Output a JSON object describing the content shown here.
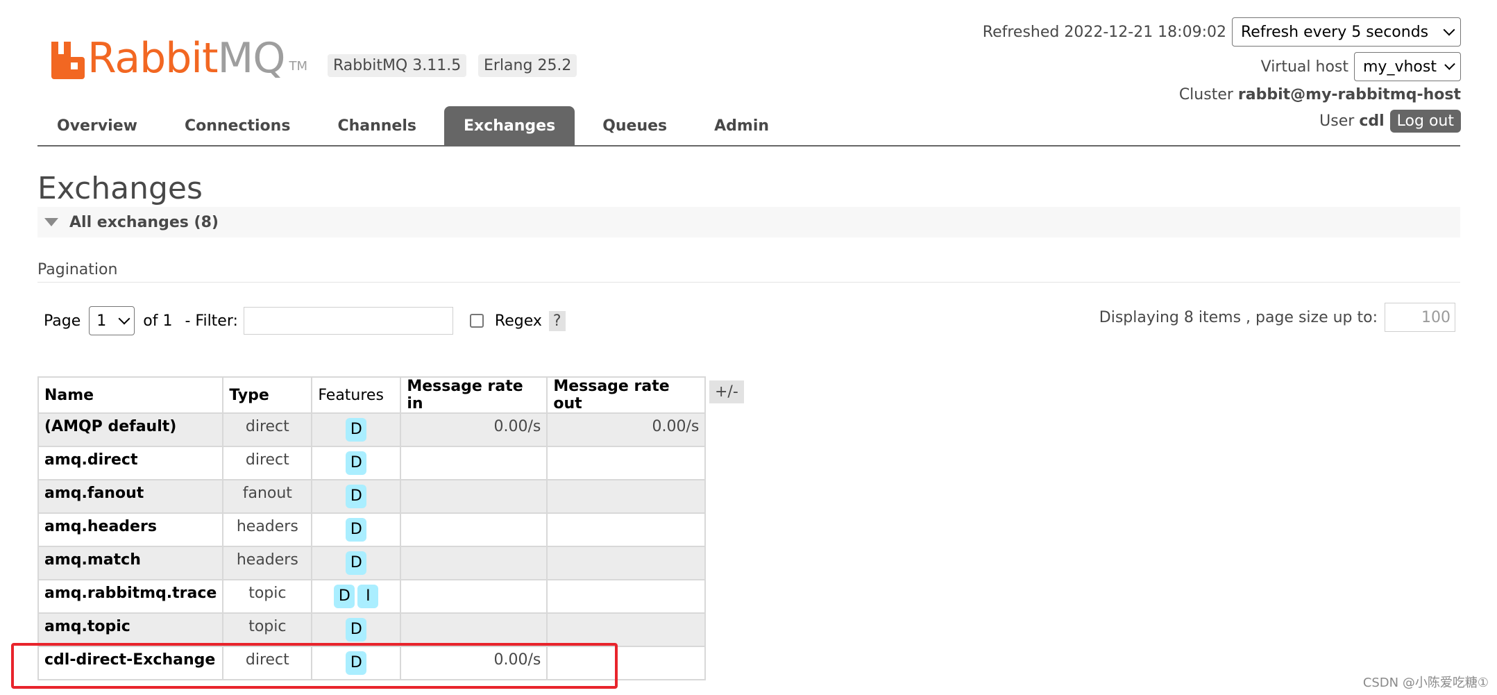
{
  "logo": {
    "rabbit": "Rabbit",
    "mq": "MQ",
    "tm": "TM"
  },
  "versions": [
    "RabbitMQ 3.11.5",
    "Erlang 25.2"
  ],
  "header": {
    "refreshed_label": "Refreshed 2022-12-21 18:09:02",
    "refresh_select": "Refresh every 5 seconds",
    "vhost_label": "Virtual host",
    "vhost_select": "my_vhost",
    "cluster_label": "Cluster",
    "cluster_name": "rabbit@my-rabbitmq-host",
    "user_label": "User",
    "user_name": "cdl",
    "logout": "Log out"
  },
  "nav": {
    "tabs": [
      {
        "label": "Overview",
        "active": false
      },
      {
        "label": "Connections",
        "active": false
      },
      {
        "label": "Channels",
        "active": false
      },
      {
        "label": "Exchanges",
        "active": true
      },
      {
        "label": "Queues",
        "active": false
      },
      {
        "label": "Admin",
        "active": false
      }
    ]
  },
  "page": {
    "title": "Exchanges",
    "section": "All exchanges (8)",
    "pagination_label": "Pagination"
  },
  "pager": {
    "page_label": "Page",
    "page_value": "1",
    "of_label": "of 1",
    "filter_label": "- Filter:",
    "filter_value": "",
    "regex_label": "Regex",
    "help": "?",
    "display_info": "Displaying 8 items , page size up to:",
    "page_size": "100"
  },
  "table": {
    "columns": [
      "Name",
      "Type",
      "Features",
      "Message rate in",
      "Message rate out"
    ],
    "toggle": "+/-",
    "rows": [
      {
        "name": "(AMQP default)",
        "type": "direct",
        "features": [
          "D"
        ],
        "rate_in": "0.00/s",
        "rate_out": "0.00/s"
      },
      {
        "name": "amq.direct",
        "type": "direct",
        "features": [
          "D"
        ],
        "rate_in": "",
        "rate_out": ""
      },
      {
        "name": "amq.fanout",
        "type": "fanout",
        "features": [
          "D"
        ],
        "rate_in": "",
        "rate_out": ""
      },
      {
        "name": "amq.headers",
        "type": "headers",
        "features": [
          "D"
        ],
        "rate_in": "",
        "rate_out": ""
      },
      {
        "name": "amq.match",
        "type": "headers",
        "features": [
          "D"
        ],
        "rate_in": "",
        "rate_out": ""
      },
      {
        "name": "amq.rabbitmq.trace",
        "type": "topic",
        "features": [
          "D",
          "I"
        ],
        "rate_in": "",
        "rate_out": ""
      },
      {
        "name": "amq.topic",
        "type": "topic",
        "features": [
          "D"
        ],
        "rate_in": "",
        "rate_out": ""
      },
      {
        "name": "cdl-direct-Exchange",
        "type": "direct",
        "features": [
          "D"
        ],
        "rate_in": "0.00/s",
        "rate_out": ""
      }
    ]
  },
  "watermark": "CSDN @小陈爱吃糖①",
  "colors": {
    "brand": "#f26722",
    "tab_active": "#666666",
    "feature_badge": "#aaeeff",
    "highlight": "#e8242c"
  }
}
